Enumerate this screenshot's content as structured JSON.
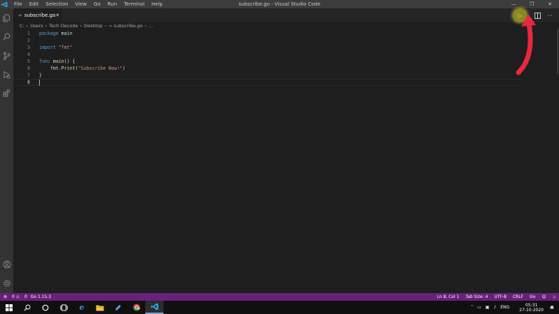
{
  "titlebar": {
    "menu": [
      "File",
      "Edit",
      "Selection",
      "View",
      "Go",
      "Run",
      "Terminal",
      "Help"
    ],
    "title": "subscribe.go - Visual Studio Code"
  },
  "tab": {
    "label": "subscribe.go"
  },
  "breadcrumb": [
    "C:",
    "Users",
    "Tech Decode",
    "Desktop",
    "subscribe.go",
    "..."
  ],
  "editor": {
    "lines": [
      {
        "n": "1",
        "text": "package main"
      },
      {
        "n": "2",
        "text": ""
      },
      {
        "n": "3",
        "text": "import \"fmt\""
      },
      {
        "n": "4",
        "text": ""
      },
      {
        "n": "5",
        "text": "func main() {"
      },
      {
        "n": "6",
        "text": "    fmt.Print(\"Subscribe Now!\")"
      },
      {
        "n": "7",
        "text": "}"
      },
      {
        "n": "8",
        "text": ""
      }
    ],
    "tokens": {
      "package": "package",
      "main": "main",
      "import": "import",
      "fmt_str": "\"fmt\"",
      "func": "func",
      "main_fn": "main",
      "main_rest": "() {",
      "fmt_obj": "fmt.",
      "print": "Print",
      "paren_open": "(",
      "subscribe_str": "\"Subscribe Now!\"",
      "paren_close": ")",
      "brace": "}"
    }
  },
  "statusbar": {
    "errors": "0",
    "warnings": "0",
    "go_version": "Go 1.15.3",
    "position": "Ln 8, Col 1",
    "tab_size": "Tab Size: 4",
    "encoding": "UTF-8",
    "eol": "CRLF",
    "language": "Go"
  },
  "taskbar": {
    "lang": "ENG",
    "time": "05:31",
    "date": "27-10-2020"
  },
  "colors": {
    "status_bar": "#68217a",
    "run_highlight": "#a8a830",
    "arrow": "#e8283e"
  },
  "icons": {
    "activity": [
      "files-icon",
      "search-icon",
      "source-control-icon",
      "run-debug-icon",
      "extensions-icon",
      "account-icon",
      "settings-gear-icon"
    ],
    "editor_actions": [
      "run-code-icon",
      "split-editor-icon",
      "more-actions-icon"
    ]
  }
}
